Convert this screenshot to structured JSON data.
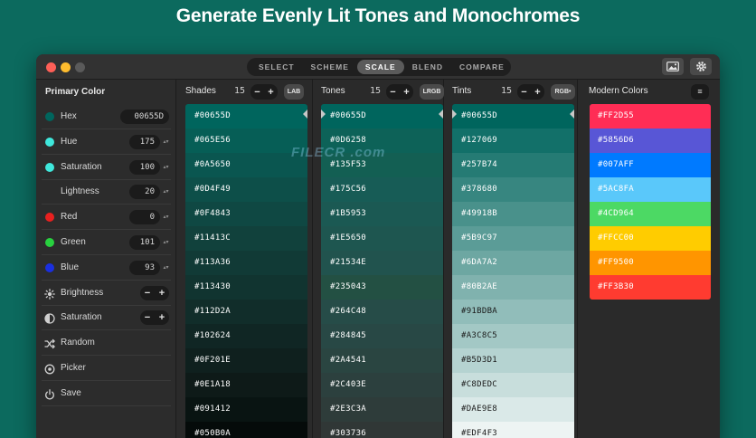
{
  "headline": "Generate Evenly Lit Tones and Monochromes",
  "watermark": "FILECR .com",
  "tabs": [
    {
      "label": "SELECT",
      "active": false
    },
    {
      "label": "SCHEME",
      "active": false
    },
    {
      "label": "SCALE",
      "active": true
    },
    {
      "label": "BLEND",
      "active": false
    },
    {
      "label": "COMPARE",
      "active": false
    }
  ],
  "toolbar_icons": [
    "image-icon",
    "gear-icon"
  ],
  "sidebar": {
    "title": "Primary Color",
    "rows": [
      {
        "label": "Hex",
        "value": "00655D",
        "dot": "#00655D",
        "kind": "value"
      },
      {
        "label": "Hue",
        "value": "175",
        "dot": "#3fe8dc",
        "kind": "value"
      },
      {
        "label": "Saturation",
        "value": "100",
        "dot": "#3fe8dc",
        "kind": "value"
      },
      {
        "label": "Lightness",
        "value": "20",
        "dot": "",
        "kind": "value"
      },
      {
        "label": "Red",
        "value": "0",
        "dot": "#e8201f",
        "kind": "value"
      },
      {
        "label": "Green",
        "value": "101",
        "dot": "#28d13f",
        "kind": "value"
      },
      {
        "label": "Blue",
        "value": "93",
        "dot": "#1a2fe0",
        "kind": "value"
      },
      {
        "label": "Brightness",
        "icon": "brightness-icon",
        "kind": "pm",
        "minus": "−",
        "plus": "+"
      },
      {
        "label": "Saturation",
        "icon": "half-circle-icon",
        "kind": "pm",
        "minus": "−",
        "plus": "+"
      },
      {
        "label": "Random",
        "icon": "shuffle-icon",
        "kind": "action"
      },
      {
        "label": "Picker",
        "icon": "picker-icon",
        "kind": "action"
      },
      {
        "label": "Save",
        "icon": "power-icon",
        "kind": "action"
      }
    ]
  },
  "columns": [
    {
      "title": "Shades",
      "count": "15",
      "space": "LAB",
      "minus": "−",
      "plus": "+",
      "colors": [
        "#00655D",
        "#065E56",
        "#0A5650",
        "#0D4F49",
        "#0F4843",
        "#11413C",
        "#113A36",
        "#113430",
        "#112D2A",
        "#102624",
        "#0F201E",
        "#0E1A18",
        "#091412",
        "#050B0A"
      ]
    },
    {
      "title": "Tones",
      "count": "15",
      "space": "LRGB",
      "minus": "−",
      "plus": "+",
      "colors": [
        "#00655D",
        "#0D6258",
        "#135F53",
        "#175C56",
        "#1B5953",
        "#1E5650",
        "#21534E",
        "#235043",
        "#264C48",
        "#284845",
        "#2A4541",
        "#2C403E",
        "#2E3C3A",
        "#303736"
      ]
    },
    {
      "title": "Tints",
      "count": "15",
      "space": "RGB•",
      "minus": "−",
      "plus": "+",
      "colors": [
        "#00655D",
        "#127069",
        "#257B74",
        "#378680",
        "#49918B",
        "#5B9C97",
        "#6DA7A2",
        "#80B2AE",
        "#91BDBA",
        "#A3C8C5",
        "#B5D3D1",
        "#C8DEDC",
        "#DAE9E8",
        "#EDF4F3"
      ]
    }
  ],
  "modern": {
    "title": "Modern Colors",
    "menu": "≡",
    "colors": [
      "#FF2D55",
      "#5856D6",
      "#007AFF",
      "#5AC8FA",
      "#4CD964",
      "#FFCC00",
      "#FF9500",
      "#FF3B30"
    ]
  }
}
